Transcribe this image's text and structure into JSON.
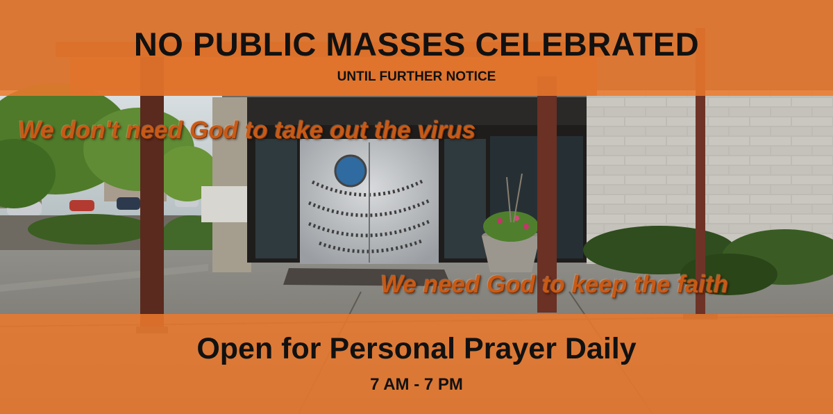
{
  "headline": "NO PUBLIC MASSES CELEBRATED",
  "subheadline": "UNTIL FURTHER NOTICE",
  "slogan_top": "We don't need God to take out the virus",
  "slogan_bottom": "We need God to keep the faith",
  "open_line": "Open for Personal Prayer Daily",
  "hours": "7 AM - 7 PM",
  "colors": {
    "banner_overlay": "#ec792c",
    "slogan_text": "#c85a17",
    "headline_text": "#111111"
  }
}
